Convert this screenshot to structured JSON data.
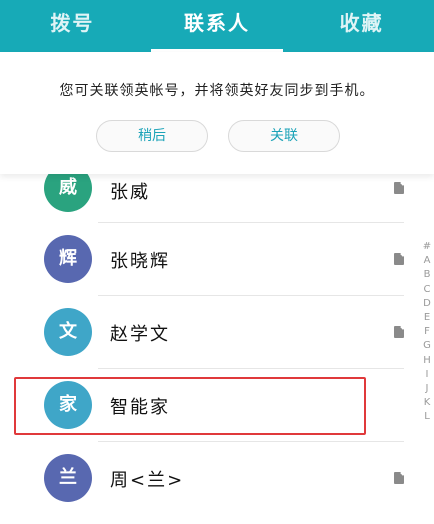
{
  "tabs": [
    {
      "label": "拨号",
      "active": false
    },
    {
      "label": "联系人",
      "active": true
    },
    {
      "label": "收藏",
      "active": false
    }
  ],
  "prompt": {
    "message": "您可关联领英帐号，并将领英好友同步到手机。",
    "later_label": "稍后",
    "link_label": "关联"
  },
  "contacts": [
    {
      "avatar_char": "威",
      "name": "张威",
      "avatar_color": "#2aa37f",
      "has_sim": true
    },
    {
      "avatar_char": "辉",
      "name": "张晓辉",
      "avatar_color": "#5868b0",
      "has_sim": true
    },
    {
      "avatar_char": "文",
      "name": "赵学文",
      "avatar_color": "#3fa6c8",
      "has_sim": true
    },
    {
      "avatar_char": "家",
      "name": "智能家",
      "avatar_color": "#3fa6c8",
      "has_sim": false
    },
    {
      "avatar_char": "兰",
      "name": "周<兰>",
      "avatar_color": "#5868b0",
      "has_sim": true
    }
  ],
  "alphabet": [
    "#",
    "A",
    "B",
    "C",
    "D",
    "E",
    "F",
    "G",
    "H",
    "I",
    "J",
    "K",
    "L"
  ],
  "colors": {
    "accent": "#17aab7",
    "highlight": "#e0393b"
  }
}
